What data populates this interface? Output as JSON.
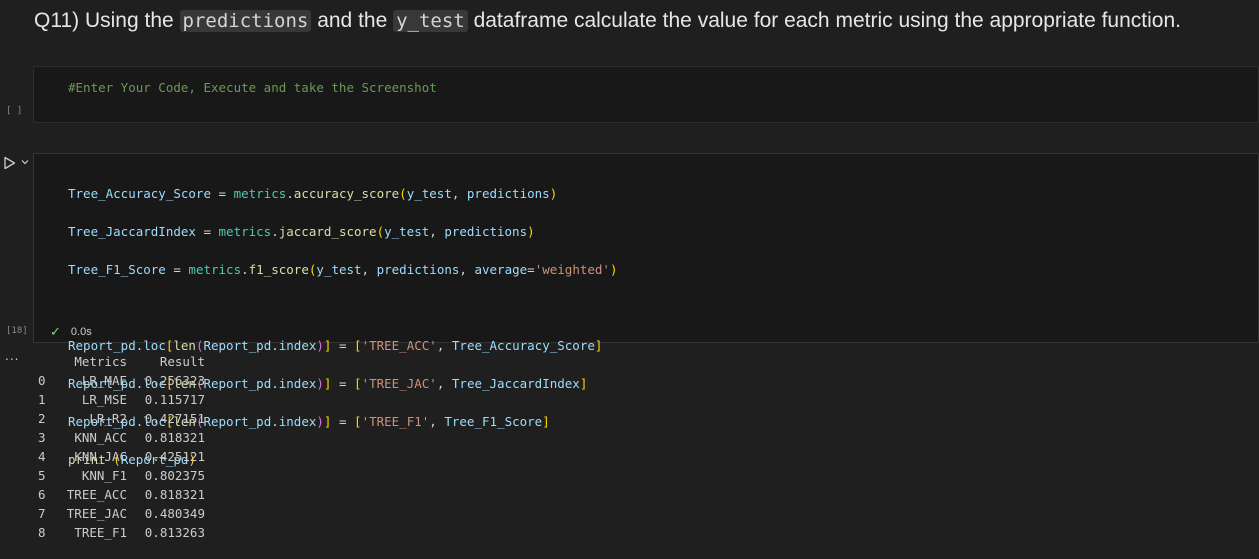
{
  "question": {
    "prefix": "Q11) Using the ",
    "code1": "predictions",
    "mid": " and the ",
    "code2": "y_test",
    "suffix": " dataframe calculate the value for each metric using the appropriate function."
  },
  "cell1": {
    "exec_count": "[ ]",
    "code": "#Enter Your Code, Execute and take the Screenshot"
  },
  "cell2": {
    "exec_count": "[18]",
    "status_time": "0.0s",
    "lines": [
      "Tree_Accuracy_Score = metrics.accuracy_score(y_test, predictions)",
      "Tree_JaccardIndex = metrics.jaccard_score(y_test, predictions)",
      "Tree_F1_Score = metrics.f1_score(y_test, predictions, average='weighted')",
      "",
      "Report_pd.loc[len(Report_pd.index)] = ['TREE_ACC', Tree_Accuracy_Score]",
      "Report_pd.loc[len(Report_pd.index)] = ['TREE_JAC', Tree_JaccardIndex]",
      "Report_pd.loc[len(Report_pd.index)] = ['TREE_F1', Tree_F1_Score]",
      "print (Report_pd)"
    ]
  },
  "output": {
    "ellipsis": "...",
    "header": {
      "idx": "",
      "metric": "Metrics",
      "result": "Result"
    },
    "rows": [
      {
        "idx": "0",
        "metric": "LR_MAE",
        "result": "0.256323"
      },
      {
        "idx": "1",
        "metric": "LR_MSE",
        "result": "0.115717"
      },
      {
        "idx": "2",
        "metric": "LR_R2",
        "result": "0.427151"
      },
      {
        "idx": "3",
        "metric": "KNN_ACC",
        "result": "0.818321"
      },
      {
        "idx": "4",
        "metric": "KNN_JAC",
        "result": "0.425121"
      },
      {
        "idx": "5",
        "metric": "KNN_F1",
        "result": "0.802375"
      },
      {
        "idx": "6",
        "metric": "TREE_ACC",
        "result": "0.818321"
      },
      {
        "idx": "7",
        "metric": "TREE_JAC",
        "result": "0.480349"
      },
      {
        "idx": "8",
        "metric": "TREE_F1",
        "result": "0.813263"
      }
    ]
  },
  "colors": {
    "background": "#1f1f1f",
    "cell_bg": "#181818",
    "comment": "#6a9955",
    "variable": "#9cdcfe",
    "function": "#dcdcaa",
    "string": "#ce9178",
    "success": "#89d185"
  }
}
